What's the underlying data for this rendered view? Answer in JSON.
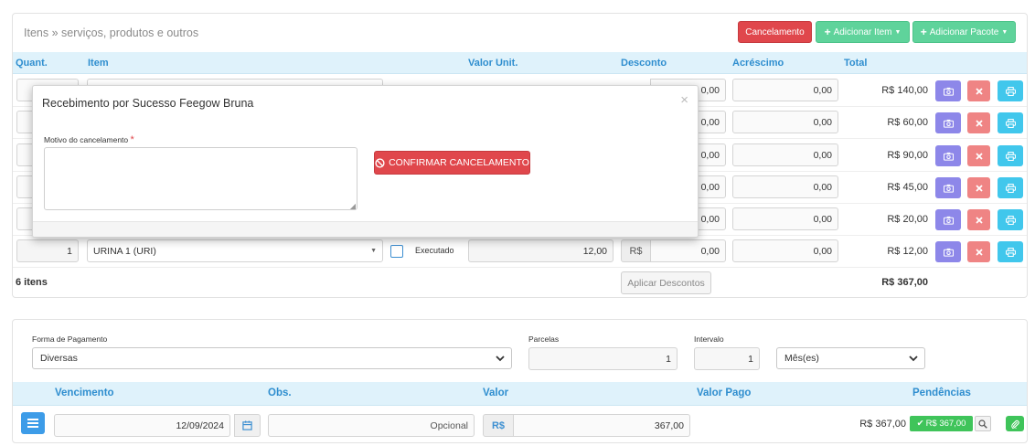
{
  "items_panel": {
    "title": "Itens » serviços, produtos e outros",
    "btn_cancel": "Cancelamento",
    "btn_add_item": "Adicionar Item",
    "btn_add_package": "Adicionar Pacote",
    "headers": {
      "qty": "Quant.",
      "item": "Item",
      "unit_value": "Valor Unit.",
      "discount": "Desconto",
      "surcharge": "Acréscimo",
      "total": "Total"
    },
    "rows": [
      {
        "discount": "0,00",
        "surcharge": "0,00",
        "total": "R$ 140,00"
      },
      {
        "discount": "0,00",
        "surcharge": "0,00",
        "total": "R$ 60,00"
      },
      {
        "discount": "0,00",
        "surcharge": "0,00",
        "total": "R$ 90,00"
      },
      {
        "discount": "0,00",
        "surcharge": "0,00",
        "total": "R$ 45,00"
      },
      {
        "discount": "0,00",
        "surcharge": "0,00",
        "total": "R$ 20,00"
      },
      {
        "qty": "1",
        "item": "URINA 1 (URI)",
        "executed_label": "Executado",
        "unit_value": "12,00",
        "currency": "R$",
        "discount": "0,00",
        "surcharge": "0,00",
        "total": "R$ 12,00"
      }
    ],
    "count_label": "6 itens",
    "apply_discounts": "Aplicar Descontos",
    "grand_total": "R$ 367,00"
  },
  "modal": {
    "title": "Recebimento por Sucesso Feegow Bruna",
    "close": "×",
    "reason_label": "Motivo do cancelamento",
    "required_mark": "*",
    "confirm_button": "CONFIRMAR CANCELAMENTO"
  },
  "payment_panel": {
    "method_label": "Forma de Pagamento",
    "method_value": "Diversas",
    "installments_label": "Parcelas",
    "installments_value": "1",
    "interval_label": "Intervalo",
    "interval_value": "1",
    "interval_unit": "Mês(es)",
    "headers": {
      "due": "Vencimento",
      "obs": "Obs.",
      "value": "Valor",
      "paid": "Valor Pago",
      "pending": "Pendências"
    },
    "row": {
      "due_date": "12/09/2024",
      "obs_placeholder": "Opcional",
      "currency": "R$",
      "value": "367,00",
      "pending_amount": "R$ 367,00",
      "pending_badge": "R$ 367,00"
    }
  },
  "colors": {
    "accent": "#2f8ecf",
    "danger": "#e0474c",
    "success": "#5fd39b",
    "header_bg": "#dff2fb"
  }
}
